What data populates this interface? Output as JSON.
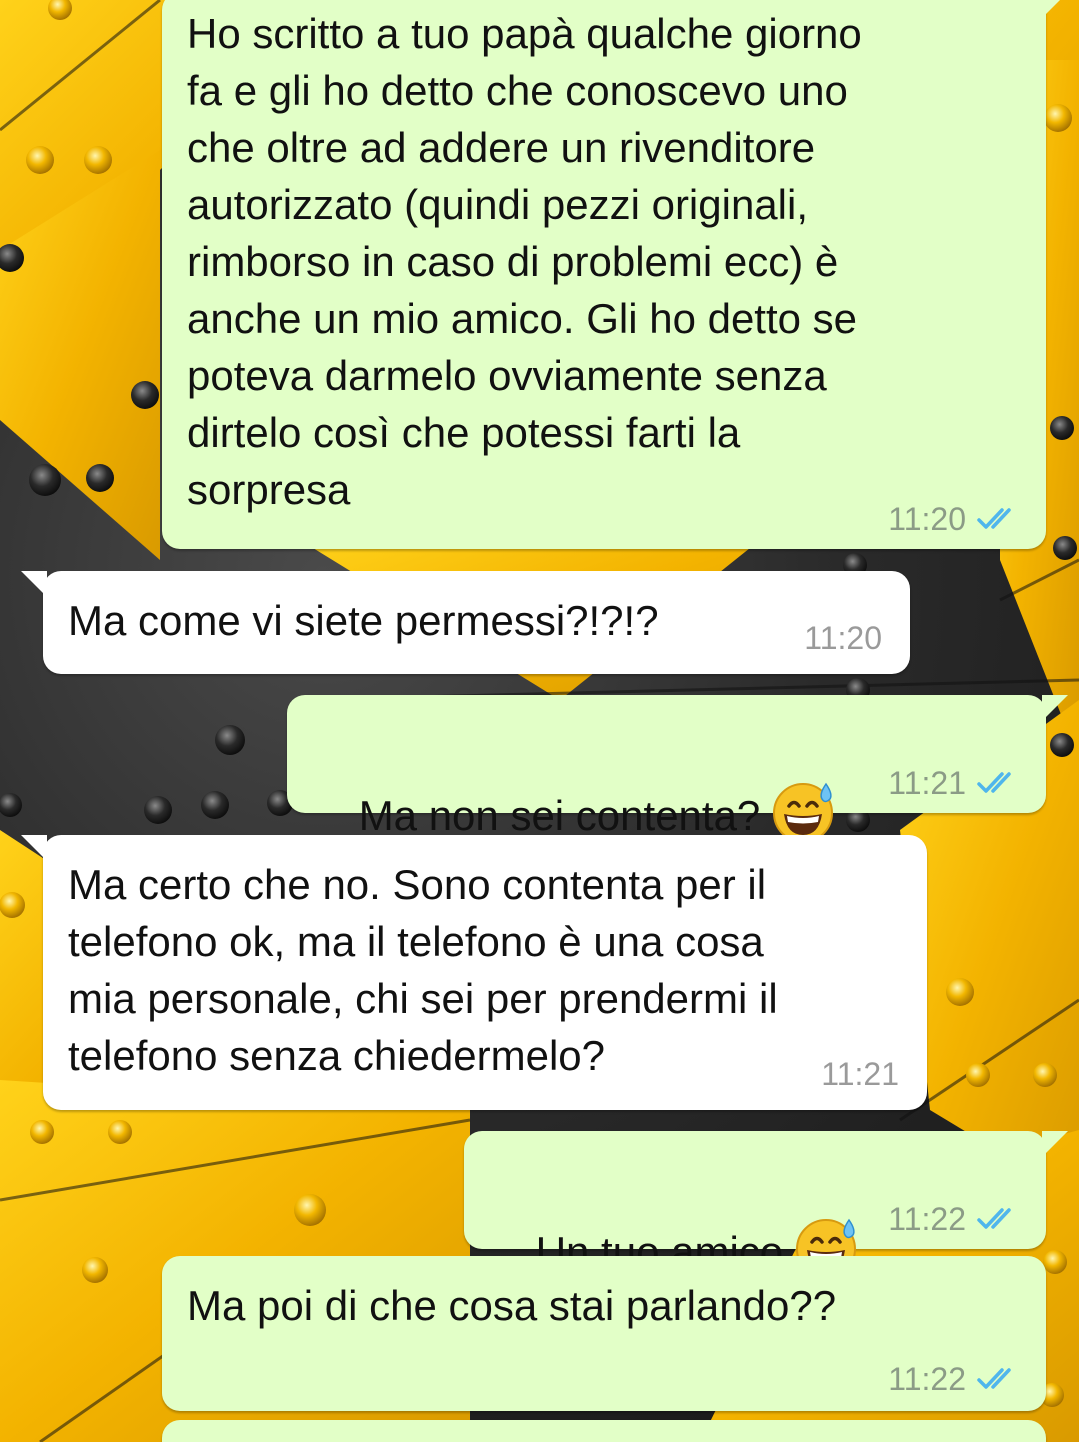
{
  "conversation": {
    "messages": [
      {
        "direction": "outgoing",
        "text": "Ho scritto a tuo papà qualche giorno\nfa e gli ho detto che conoscevo uno\nche oltre ad addere un rivenditore\nautorizzato (quindi pezzi originali,\nrimborso in caso di problemi ecc) è\nanche un mio amico. Gli ho detto se\npoteva darmelo ovviamente senza\ndirtelo così che potessi farti la\nsorpresa",
        "time": "11:20",
        "status_icon": "double-check-read-icon"
      },
      {
        "direction": "incoming",
        "text": "Ma come vi siete permessi?!?!?",
        "time": "11:20"
      },
      {
        "direction": "outgoing",
        "text": "Ma non sei contenta?",
        "emoji": "grinning-face-with-sweat-icon",
        "time": "11:21",
        "status_icon": "double-check-read-icon"
      },
      {
        "direction": "incoming",
        "text": "Ma certo che no. Sono contenta per il\ntelefono ok, ma il telefono è una cosa\nmia personale, chi sei per prendermi il\ntelefono senza chiedermelo?",
        "time": "11:21"
      },
      {
        "direction": "outgoing",
        "text": "Un tuo amico",
        "emoji": "grinning-face-with-sweat-icon",
        "time": "11:22",
        "status_icon": "double-check-read-icon"
      },
      {
        "direction": "outgoing",
        "text": "Ma poi di che cosa stai parlando??",
        "time": "11:22",
        "status_icon": "double-check-read-icon"
      }
    ]
  },
  "colors": {
    "outgoing_bubble": "#e2ffc7",
    "incoming_bubble": "#ffffff",
    "read_ticks": "#4fb6ec",
    "wallpaper_yellow": "#f5b800",
    "wallpaper_steel": "#2c2c2c"
  }
}
